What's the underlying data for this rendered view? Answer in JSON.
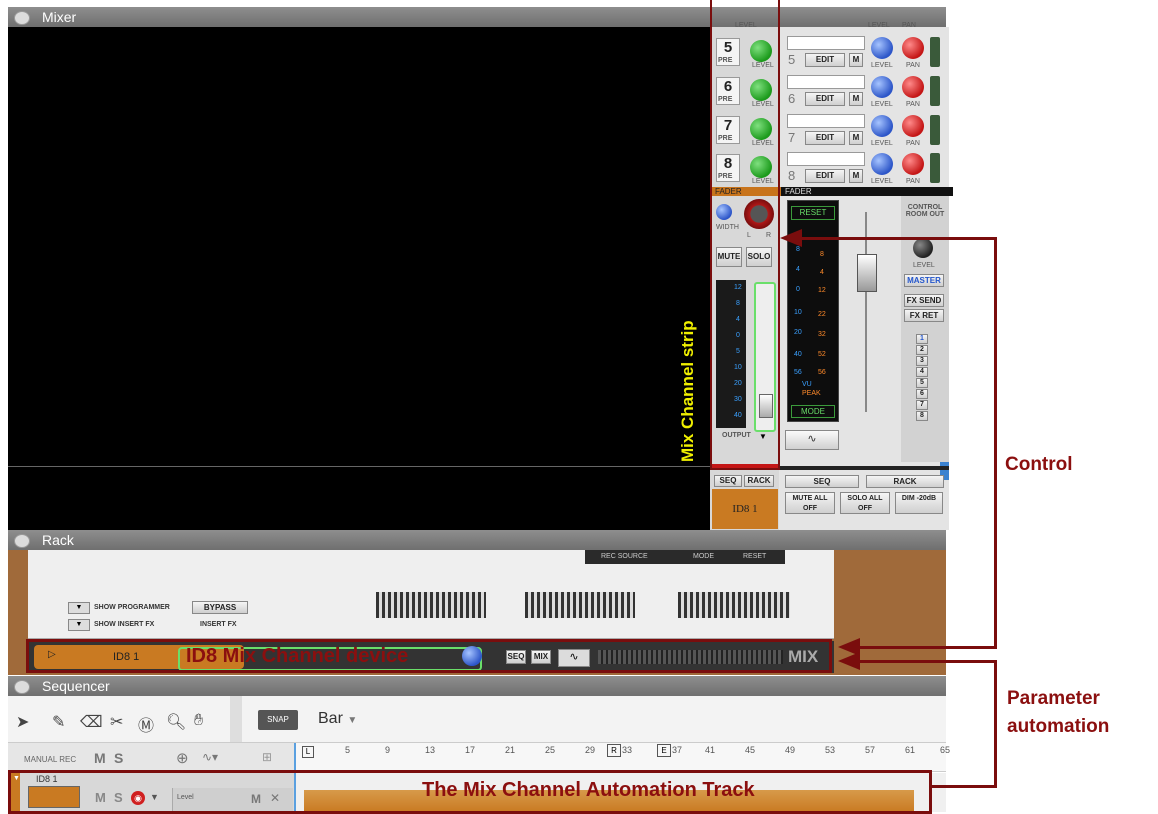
{
  "mixer": {
    "title": "Mixer",
    "channels": [
      {
        "num": "5",
        "pre": "PRE",
        "level": "LEVEL"
      },
      {
        "num": "6",
        "pre": "PRE",
        "level": "LEVEL"
      },
      {
        "num": "7",
        "pre": "PRE",
        "level": "LEVEL"
      },
      {
        "num": "8",
        "pre": "PRE",
        "level": "LEVEL"
      }
    ],
    "fx_rows": [
      {
        "num": "5",
        "edit": "EDIT",
        "m": "M",
        "level": "LEVEL",
        "pan": "PAN"
      },
      {
        "num": "6",
        "edit": "EDIT",
        "m": "M",
        "level": "LEVEL",
        "pan": "PAN"
      },
      {
        "num": "7",
        "edit": "EDIT",
        "m": "M",
        "level": "LEVEL",
        "pan": "PAN"
      },
      {
        "num": "8",
        "edit": "EDIT",
        "m": "M",
        "level": "LEVEL",
        "pan": "PAN"
      }
    ],
    "top_labels": {
      "level": "LEVEL",
      "level2": "LEVEL",
      "pan": "PAN"
    },
    "fader_label": "FADER",
    "fader_label2": "FADER",
    "width_label": "WIDTH",
    "l": "L",
    "r": "R",
    "mute": "MUTE",
    "solo": "SOLO",
    "output": "OUTPUT",
    "meter_scale": [
      "12",
      "8",
      "4",
      "0",
      "5",
      "10",
      "20",
      "30",
      "40",
      "56"
    ],
    "master_scale_left": [
      "8",
      "4",
      "0",
      "10",
      "20",
      "40",
      "56"
    ],
    "master_scale_right": [
      "8",
      "4",
      "12",
      "22",
      "32",
      "52",
      "56"
    ],
    "reset": "RESET",
    "vu": "VU",
    "peak": "PEAK",
    "mode": "MODE",
    "control_room": "CONTROL ROOM OUT",
    "cr_level": "LEVEL",
    "master": "MASTER",
    "fx_send": "FX SEND",
    "fx_ret": "FX RET",
    "numbered": [
      "1",
      "2",
      "3",
      "4",
      "5",
      "6",
      "7",
      "8"
    ],
    "seq": "SEQ",
    "rack": "RACK",
    "seq2": "SEQ",
    "rack2": "RACK",
    "channel_name": "ID8 1",
    "mute_all": "MUTE ALL OFF",
    "solo_all": "SOLO ALL OFF",
    "dim": "DIM -20dB"
  },
  "rack": {
    "title": "Rack",
    "rec_source": "REC SOURCE",
    "mode": "MODE",
    "reset": "RESET",
    "show_programmer": "SHOW PROGRAMMER",
    "show_insert_fx": "SHOW INSERT FX",
    "bypass": "BYPASS",
    "insert_fx": "INSERT FX",
    "device_name": "ID8 1",
    "seq": "SEQ",
    "mix": "MIX",
    "mix_logo": "MIX"
  },
  "sequencer": {
    "title": "Sequencer",
    "snap": "SNAP",
    "bar": "Bar",
    "manual_rec": "MANUAL REC",
    "m": "M",
    "s": "S",
    "ruler": [
      "5",
      "9",
      "13",
      "17",
      "21",
      "25",
      "29",
      "33",
      "37",
      "41",
      "45",
      "49",
      "53",
      "57",
      "61",
      "65"
    ],
    "ruler_l": "L",
    "ruler_r": "R",
    "ruler_e": "E",
    "track_name": "ID8 1",
    "track_m": "M",
    "track_s": "S",
    "lane_label": "Level",
    "lane_m": "M"
  },
  "annotations": {
    "mix_channel_strip": "Mix Channel strip",
    "control": "Control",
    "parameter_automation": "Parameter automation",
    "mix_channel_device": "ID8 Mix Channel device",
    "automation_track": "The Mix Channel Automation Track"
  },
  "colors": {
    "annotation": "#8b0f0f",
    "strip_label": "#f0f000",
    "device_orange": "#c97a22"
  }
}
